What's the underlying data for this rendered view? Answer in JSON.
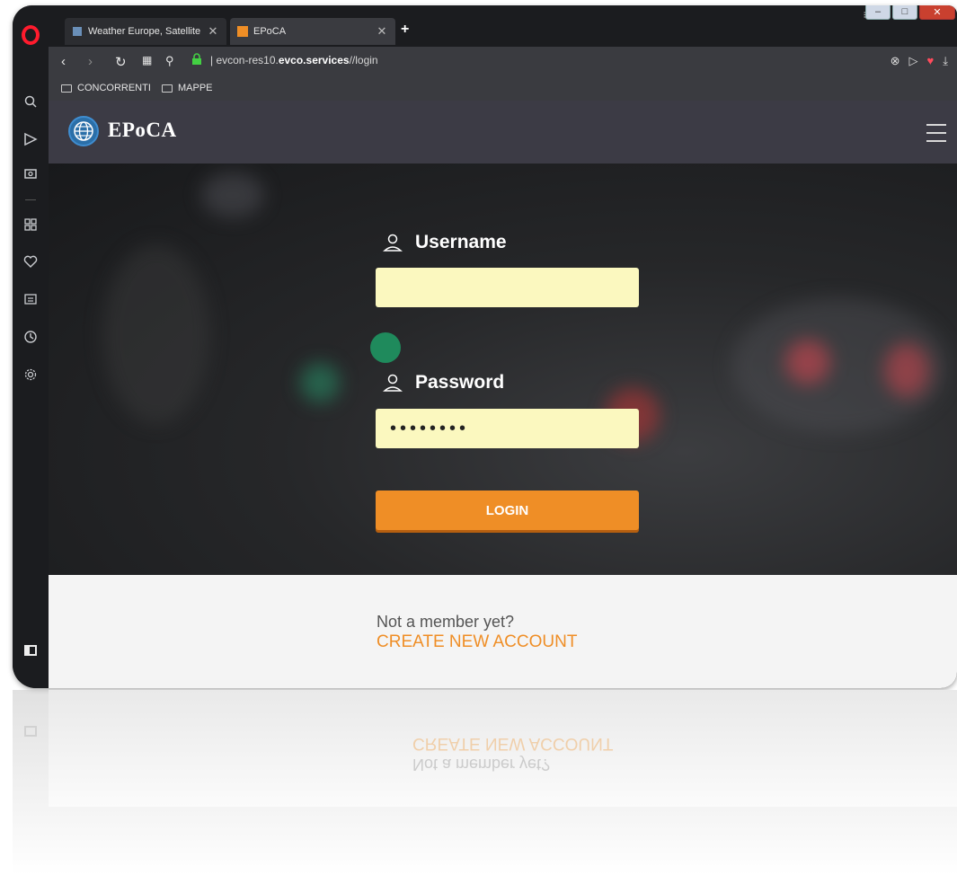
{
  "browser": {
    "tabs": [
      {
        "title": "Weather Europe, Satellite",
        "active": false
      },
      {
        "title": "EPoCA",
        "active": true
      }
    ],
    "url_prefix": "evcon-res10.",
    "url_domain": "evco.services",
    "url_path": "//login",
    "bookmarks": [
      "CONCORRENTI",
      "MAPPE"
    ]
  },
  "site": {
    "brand": "EPoCA"
  },
  "login": {
    "username_label": "Username",
    "username_value": "",
    "password_label": "Password",
    "password_value": "••••••••",
    "login_button": "LOGIN"
  },
  "signup": {
    "prompt": "Not a member yet?",
    "link": "CREATE NEW ACCOUNT"
  },
  "colors": {
    "accent_orange": "#ef8e26",
    "input_bg": "#fbf8bf",
    "navbar_bg": "#3c3b45"
  },
  "icons": {
    "sidebar": [
      "search-icon",
      "send-icon",
      "camera-icon",
      "speed-dial-icon",
      "heart-icon",
      "news-icon",
      "history-icon",
      "settings-icon"
    ]
  }
}
